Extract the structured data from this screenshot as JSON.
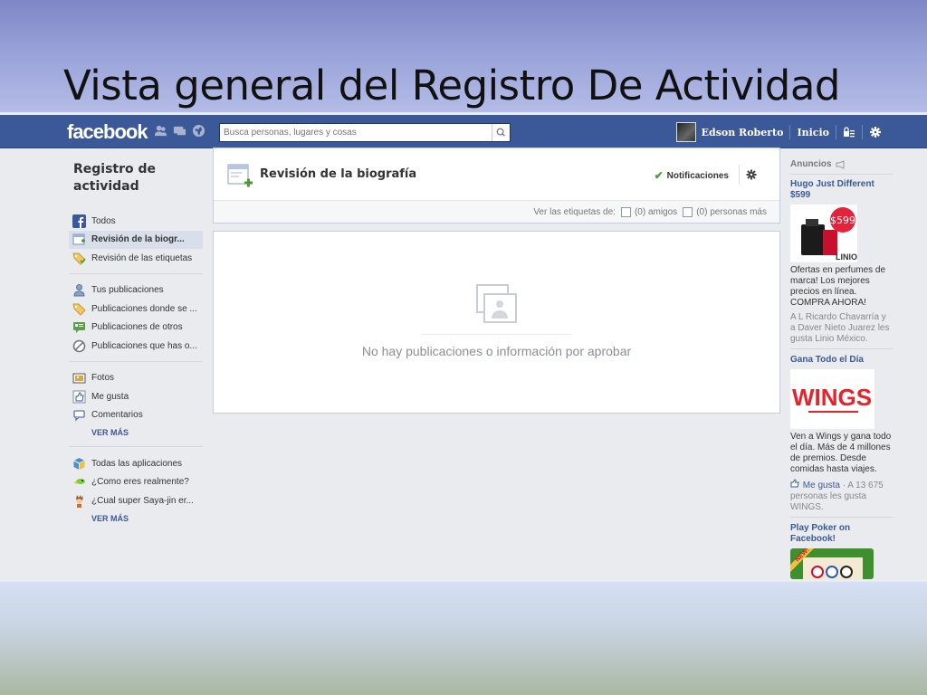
{
  "slide": {
    "title": "Vista general del Registro De Actividad"
  },
  "topbar": {
    "logo": "facebook",
    "search_placeholder": "Busca personas, lugares y cosas",
    "user_name": "Edson Roberto",
    "home_label": "Inicio",
    "icons": [
      "friends-icon",
      "messages-icon",
      "notifications-globe-icon",
      "privacy-shortcuts-icon",
      "settings-gear-icon"
    ]
  },
  "sidebar": {
    "title": "Registro de actividad",
    "group1": [
      {
        "label": "Todos",
        "icon": "facebook-icon"
      },
      {
        "label": "Revisión de la biogr...",
        "icon": "timeline-review-icon",
        "active": true
      },
      {
        "label": "Revisión de las etiquetas",
        "icon": "tag-review-icon"
      }
    ],
    "group2": [
      {
        "label": "Tus publicaciones",
        "icon": "user-icon"
      },
      {
        "label": "Publicaciones donde se ...",
        "icon": "tag-icon"
      },
      {
        "label": "Publicaciones de otros",
        "icon": "posts-icon"
      },
      {
        "label": "Publicaciones que has o...",
        "icon": "hidden-icon"
      }
    ],
    "group3": [
      {
        "label": "Fotos",
        "icon": "photos-icon"
      },
      {
        "label": "Me gusta",
        "icon": "like-icon"
      },
      {
        "label": "Comentarios",
        "icon": "comment-icon"
      }
    ],
    "group4": [
      {
        "label": "Todas las aplicaciones",
        "icon": "apps-icon"
      },
      {
        "label": "¿Como eres realmente?",
        "icon": "app-bird-icon"
      },
      {
        "label": "¿Cual super Saya-jin er...",
        "icon": "app-saiyan-icon"
      }
    ],
    "ver_mas": "VER MÁS"
  },
  "review_panel": {
    "title": "Revisión de la biografía",
    "notifications_label": "Notificaciones",
    "tags_label": "Ver las etiquetas de:",
    "friends_option": "(0) amigos",
    "others_option": "(0) personas más"
  },
  "empty_state": {
    "message": "No hay publicaciones o información por aprobar"
  },
  "ads": {
    "header": "Anuncios",
    "items": [
      {
        "title": "Hugo Just Different $599",
        "price_badge": "$599",
        "brand": "LINIO",
        "body": "Ofertas en perfumes de marca! Los mejores precios en línea. COMPRA AHORA!",
        "social": "A L Ricardo Chavarría y a Daver Nieto Juarez les gusta Linio México."
      },
      {
        "title": "Gana Todo el Día",
        "brand": "WINGS",
        "body": "Ven a Wings y gana todo el día. Más de 4 millones de premios. Desde comidas hasta viajes.",
        "like_label": "Me gusta",
        "social": " · A 13 675 personas les gusta WINGS."
      },
      {
        "title": "Play Poker on Facebook!",
        "badge": "NEW!"
      }
    ]
  },
  "colors": {
    "facebook_blue": "#3b5998",
    "page_bg": "#e9ebee",
    "check_green": "#4b9a36"
  }
}
